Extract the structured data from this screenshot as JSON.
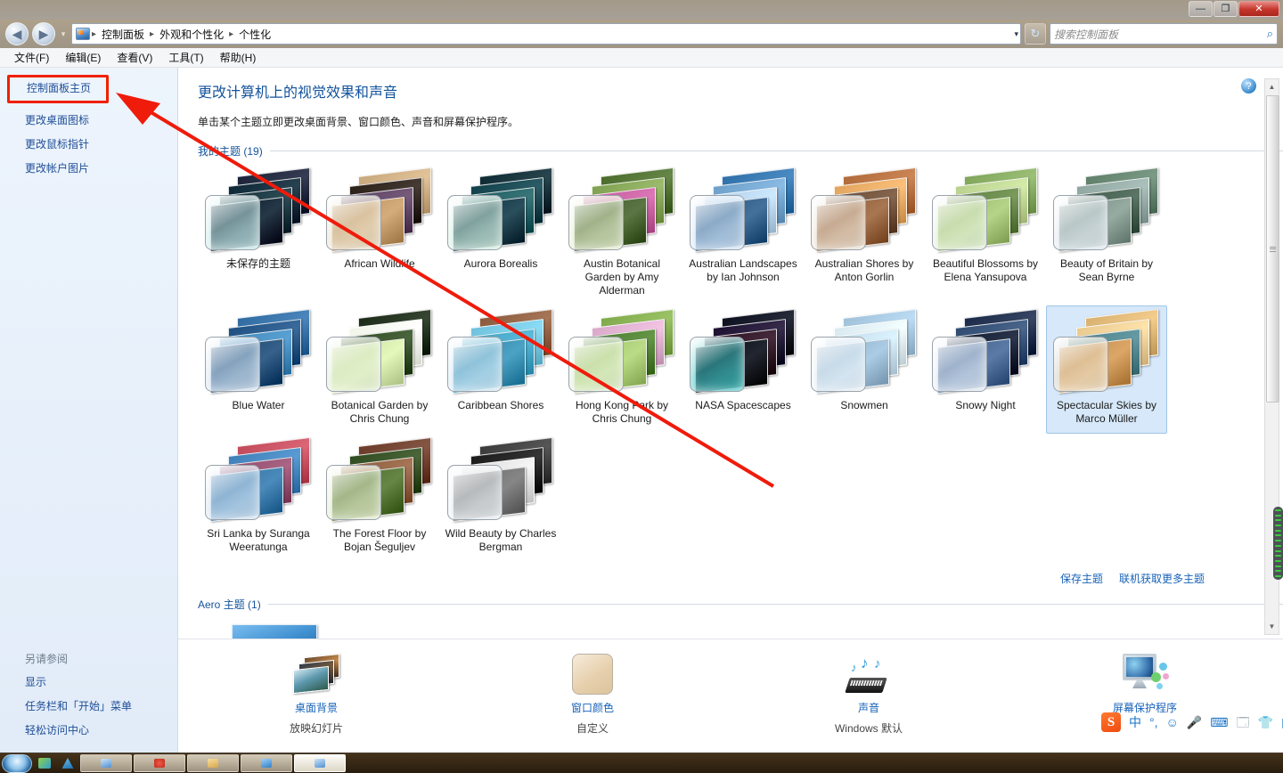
{
  "window": {
    "buttons": {
      "minimize": "—",
      "maximize": "❐",
      "close": "✕"
    }
  },
  "addressbar": {
    "back_icon": "◀",
    "forward_icon": "▶",
    "history_icon": "▾",
    "breadcrumb": [
      "控制面板",
      "外观和个性化",
      "个性化"
    ],
    "breadcrumb_sep": "▸",
    "dropdown_icon": "▾",
    "refresh_icon": "↻",
    "search_placeholder": "搜索控制面板",
    "search_value": "",
    "search_icon": "⌕"
  },
  "menubar": [
    {
      "label": "文件(F)"
    },
    {
      "label": "编辑(E)"
    },
    {
      "label": "查看(V)"
    },
    {
      "label": "工具(T)"
    },
    {
      "label": "帮助(H)"
    }
  ],
  "help_icon": "?",
  "sidebar": {
    "home": "控制面板主页",
    "items": [
      {
        "label": "更改桌面图标"
      },
      {
        "label": "更改鼠标指针"
      },
      {
        "label": "更改帐户图片"
      }
    ],
    "see_also_head": "另请参阅",
    "see_also": [
      {
        "label": "显示"
      },
      {
        "label": "任务栏和「开始」菜单"
      },
      {
        "label": "轻松访问中心"
      }
    ]
  },
  "content": {
    "title": "更改计算机上的视觉效果和声音",
    "subtitle": "单击某个主题立即更改桌面背景、窗口颜色、声音和屏幕保护程序。",
    "groups": [
      {
        "name": "我的主题",
        "count": "(19)",
        "themes": [
          {
            "label": "未保存的主题",
            "selected": false,
            "glass": "#bfe6e6",
            "cards": [
              "#1b2238",
              "#0c2636",
              "#12303a",
              "#0a1c2b"
            ]
          },
          {
            "label": "African Wildlife",
            "selected": false,
            "glass": "#e6ddc7",
            "cards": [
              "#c7a77c",
              "#2a2018",
              "#5a3f5e",
              "#b88f5e"
            ]
          },
          {
            "label": "Aurora Borealis",
            "selected": false,
            "glass": "#cfeede",
            "cards": [
              "#0d2a33",
              "#10404a",
              "#1d5a5e",
              "#0e3340"
            ]
          },
          {
            "label": "Austin Botanical Garden by Amy Alderman",
            "selected": false,
            "glass": "#e3eccb",
            "cards": [
              "#4a6b2c",
              "#7fa050",
              "#c05a9a",
              "#3f5a28"
            ]
          },
          {
            "label": "Australian Landscapes by Ian Johnson",
            "selected": false,
            "glass": "#cfe2f5",
            "cards": [
              "#2f6fa8",
              "#6d9fc9",
              "#b0cde4",
              "#27557f"
            ]
          },
          {
            "label": "Australian Shores by Anton Gorlin",
            "selected": false,
            "glass": "#e9dfd0",
            "cards": [
              "#b06a3a",
              "#e0a45e",
              "#6a4a33",
              "#8c5a35"
            ]
          },
          {
            "label": "Beautiful Blossoms by Elena Yansupova",
            "selected": false,
            "glass": "#dfecd5",
            "cards": [
              "#7fa45a",
              "#b8cf8e",
              "#5e7f3f",
              "#9ab86c"
            ]
          },
          {
            "label": "Beauty of Britain by Sean Byrne",
            "selected": false,
            "glass": "#dfe7ef",
            "cards": [
              "#5f7f6a",
              "#8fa5a0",
              "#3f5a4a",
              "#7a8f85"
            ]
          },
          {
            "label": "Blue Water",
            "selected": false,
            "glass": "#cfe0f0",
            "cards": [
              "#2f6aa0",
              "#1e4f80",
              "#3f86b8",
              "#19456e"
            ]
          },
          {
            "label": "Botanical Garden by Chris Chung",
            "selected": false,
            "glass": "#dfead0",
            "cards": [
              "#1b2a16",
              "#f0f4e8",
              "#2f4a22",
              "#c8dca0"
            ]
          },
          {
            "label": "Caribbean Shores",
            "selected": false,
            "glass": "#cfe6f4",
            "cards": [
              "#8b5a3c",
              "#6fc0da",
              "#3f9fc0",
              "#2f86a8"
            ]
          },
          {
            "label": "Hong Kong Park by Chris Chung",
            "selected": false,
            "glass": "#e0ecd2",
            "cards": [
              "#7fa84a",
              "#d8a8c8",
              "#4a7a2c",
              "#9ec06a"
            ]
          },
          {
            "label": "NASA Spacescapes",
            "selected": false,
            "glass": "#39c0c0",
            "cards": [
              "#0b0f1e",
              "#1b1030",
              "#2a0f20",
              "#060a14"
            ]
          },
          {
            "label": "Snowmen",
            "selected": false,
            "glass": "#e8f0f6",
            "cards": [
              "#9fc0d8",
              "#d8e8f0",
              "#c0d8e8",
              "#8fb0c8"
            ]
          },
          {
            "label": "Snowy Night",
            "selected": false,
            "glass": "#dfe9f4",
            "cards": [
              "#1b2a48",
              "#2f4a70",
              "#0f1a30",
              "#3f5f8a"
            ]
          },
          {
            "label": "Spectacular Skies by Marco Müller",
            "selected": true,
            "glass": "#e8dcc4",
            "cards": [
              "#d8b070",
              "#e8c88f",
              "#4a7f88",
              "#c08a4a"
            ]
          },
          {
            "label": "Sri Lanka by Suranga Weeratunga",
            "selected": false,
            "glass": "#cfe0f0",
            "cards": [
              "#c04a5a",
              "#3f7fb8",
              "#8f4a6a",
              "#2f6fa0"
            ]
          },
          {
            "label": "The Forest Floor by Bojan Šeguljev",
            "selected": false,
            "glass": "#e0e8c8",
            "cards": [
              "#6a3a28",
              "#2f4a1f",
              "#8a5a3a",
              "#4a6a2a"
            ]
          },
          {
            "label": "Wild Beauty by Charles Bergman",
            "selected": false,
            "glass": "#e8eef2",
            "cards": [
              "#3a3a3a",
              "#1a1a1a",
              "#dadada",
              "#6a6a6a"
            ]
          }
        ]
      }
    ],
    "links": [
      {
        "label": "保存主题"
      },
      {
        "label": "联机获取更多主题"
      }
    ],
    "aero_group": {
      "name_prefix": "Aero ",
      "name": "主题",
      "count": "(1)"
    }
  },
  "actions": [
    {
      "icon": "desktop-background-icon",
      "label": "桌面背景",
      "value": "放映幻灯片"
    },
    {
      "icon": "window-color-icon",
      "label": "窗口颜色",
      "value": "自定义"
    },
    {
      "icon": "sound-icon",
      "label": "声音",
      "value": "Windows 默认"
    },
    {
      "icon": "screensaver-icon",
      "label": "屏幕保护程序",
      "value": ""
    }
  ],
  "ime": {
    "logo": "S",
    "items": [
      {
        "name": "chinese-mode-icon",
        "glyph": "中"
      },
      {
        "name": "punctuation-icon",
        "glyph": "°,"
      },
      {
        "name": "emoji-icon",
        "glyph": "☺"
      },
      {
        "name": "voice-input-icon",
        "glyph": "🎤"
      },
      {
        "name": "soft-keyboard-icon",
        "glyph": "⌨"
      },
      {
        "name": "toolbox-icon",
        "glyph": "🗔"
      },
      {
        "name": "skin-icon",
        "glyph": "👕"
      },
      {
        "name": "apps-icon",
        "glyph": "▤"
      }
    ]
  },
  "scrollbar": {
    "up_arrow": "▲",
    "down_arrow": "▼"
  },
  "annotation": {
    "color": "#ef1b0b",
    "highlight_target": "控制面板主页"
  }
}
